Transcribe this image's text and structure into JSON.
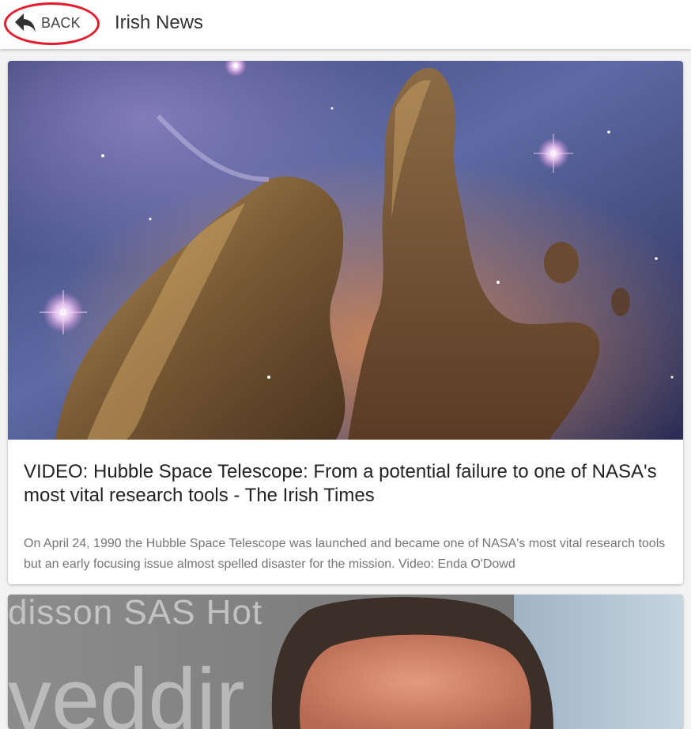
{
  "header": {
    "back_label": "BACK",
    "title": "Irish News"
  },
  "articles": [
    {
      "image": "hubble-nebula-image",
      "title": "VIDEO: Hubble Space Telescope: From a potential failure to one of NASA's most vital research tools - The Irish Times",
      "description": "On April 24, 1990 the Hubble Space Telescope was launched and became one of NASA's most vital research tools but an early focusing issue almost spelled disaster for the mission. Video: Enda O'Dowd"
    },
    {
      "image": "person-photo-image",
      "sign_text_line1": "disson SAS Hot",
      "sign_text_line2": "veddir"
    }
  ],
  "colors": {
    "annotation": "#e8192c",
    "header_bg": "#ffffff",
    "page_bg": "#f3f3f3"
  },
  "icons": {
    "back": "reply-arrow-icon"
  }
}
